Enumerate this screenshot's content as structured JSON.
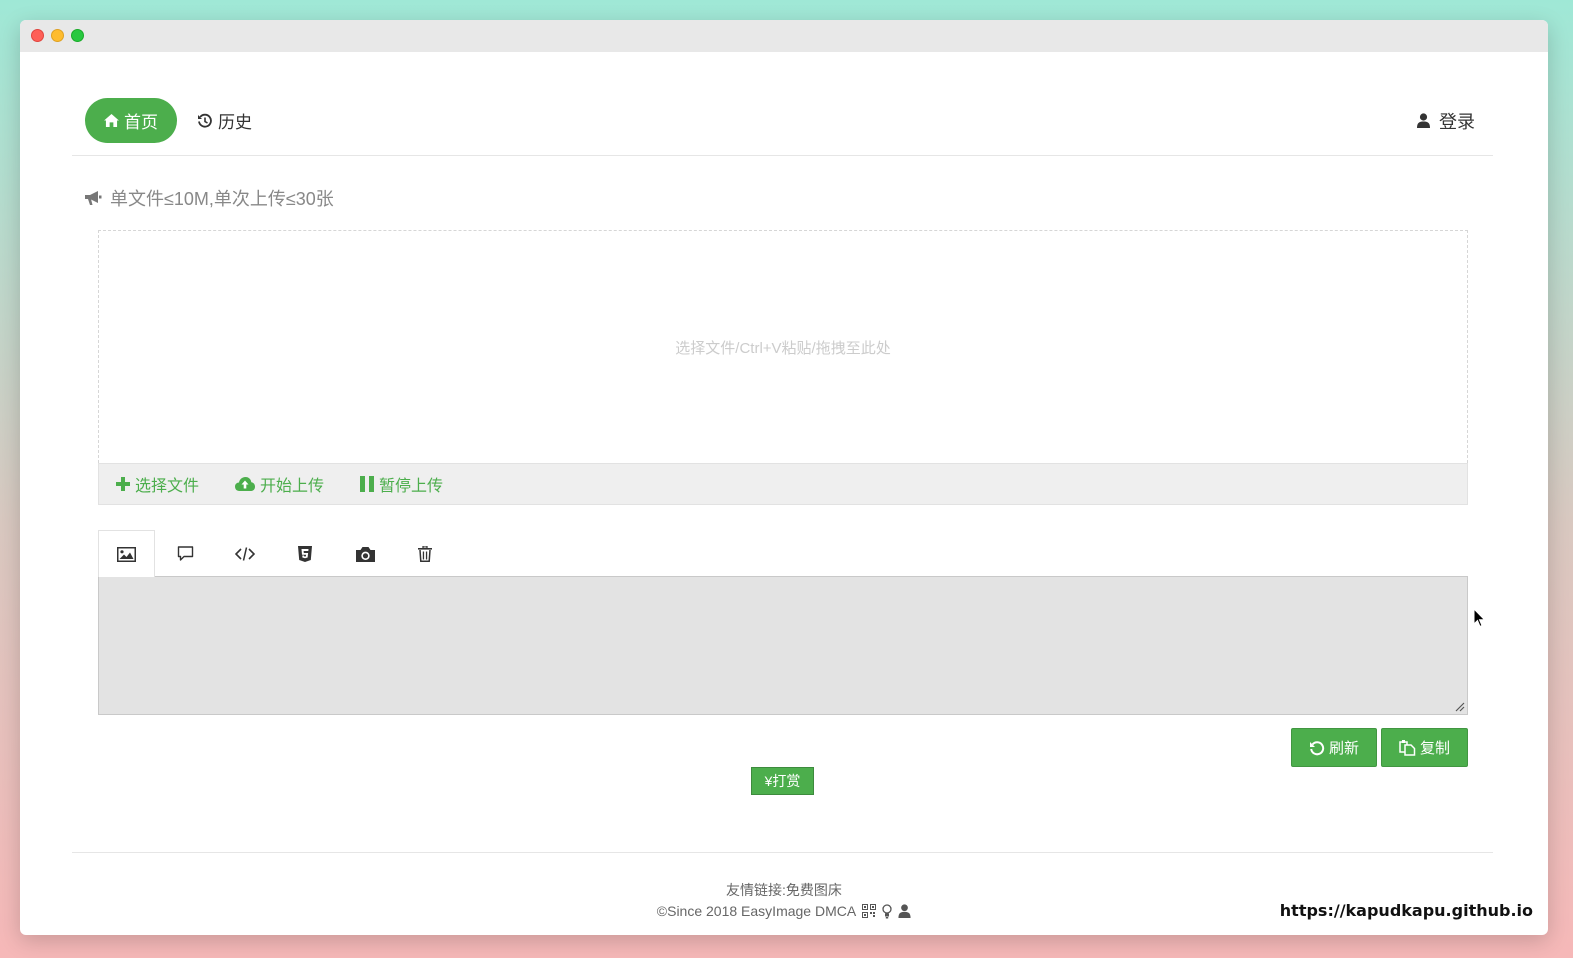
{
  "nav": {
    "home_label": "首页",
    "history_label": "历史",
    "login_label": "登录"
  },
  "notice": "单文件≤10M,单次上传≤30张",
  "dropzone": {
    "hint": "选择文件/Ctrl+V粘贴/拖拽至此处"
  },
  "upload_actions": {
    "select_label": "选择文件",
    "start_label": "开始上传",
    "pause_label": "暂停上传"
  },
  "tabs": [
    {
      "icon": "image-icon"
    },
    {
      "icon": "comment-icon"
    },
    {
      "icon": "code-icon"
    },
    {
      "icon": "html5-icon"
    },
    {
      "icon": "camera-icon"
    },
    {
      "icon": "trash-icon"
    }
  ],
  "output": {
    "value": ""
  },
  "actions": {
    "refresh_label": "刷新",
    "copy_label": "复制",
    "donate_label": "¥打赏"
  },
  "footer": {
    "links": "友情链接:免费图床",
    "copyright": "©Since 2018 EasyImage DMCA"
  },
  "watermark": "https://kapudkapu.github.io",
  "colors": {
    "accent": "#4cae4c",
    "nav_divider": "#e6e6e6",
    "output_bg": "#e3e3e3"
  }
}
